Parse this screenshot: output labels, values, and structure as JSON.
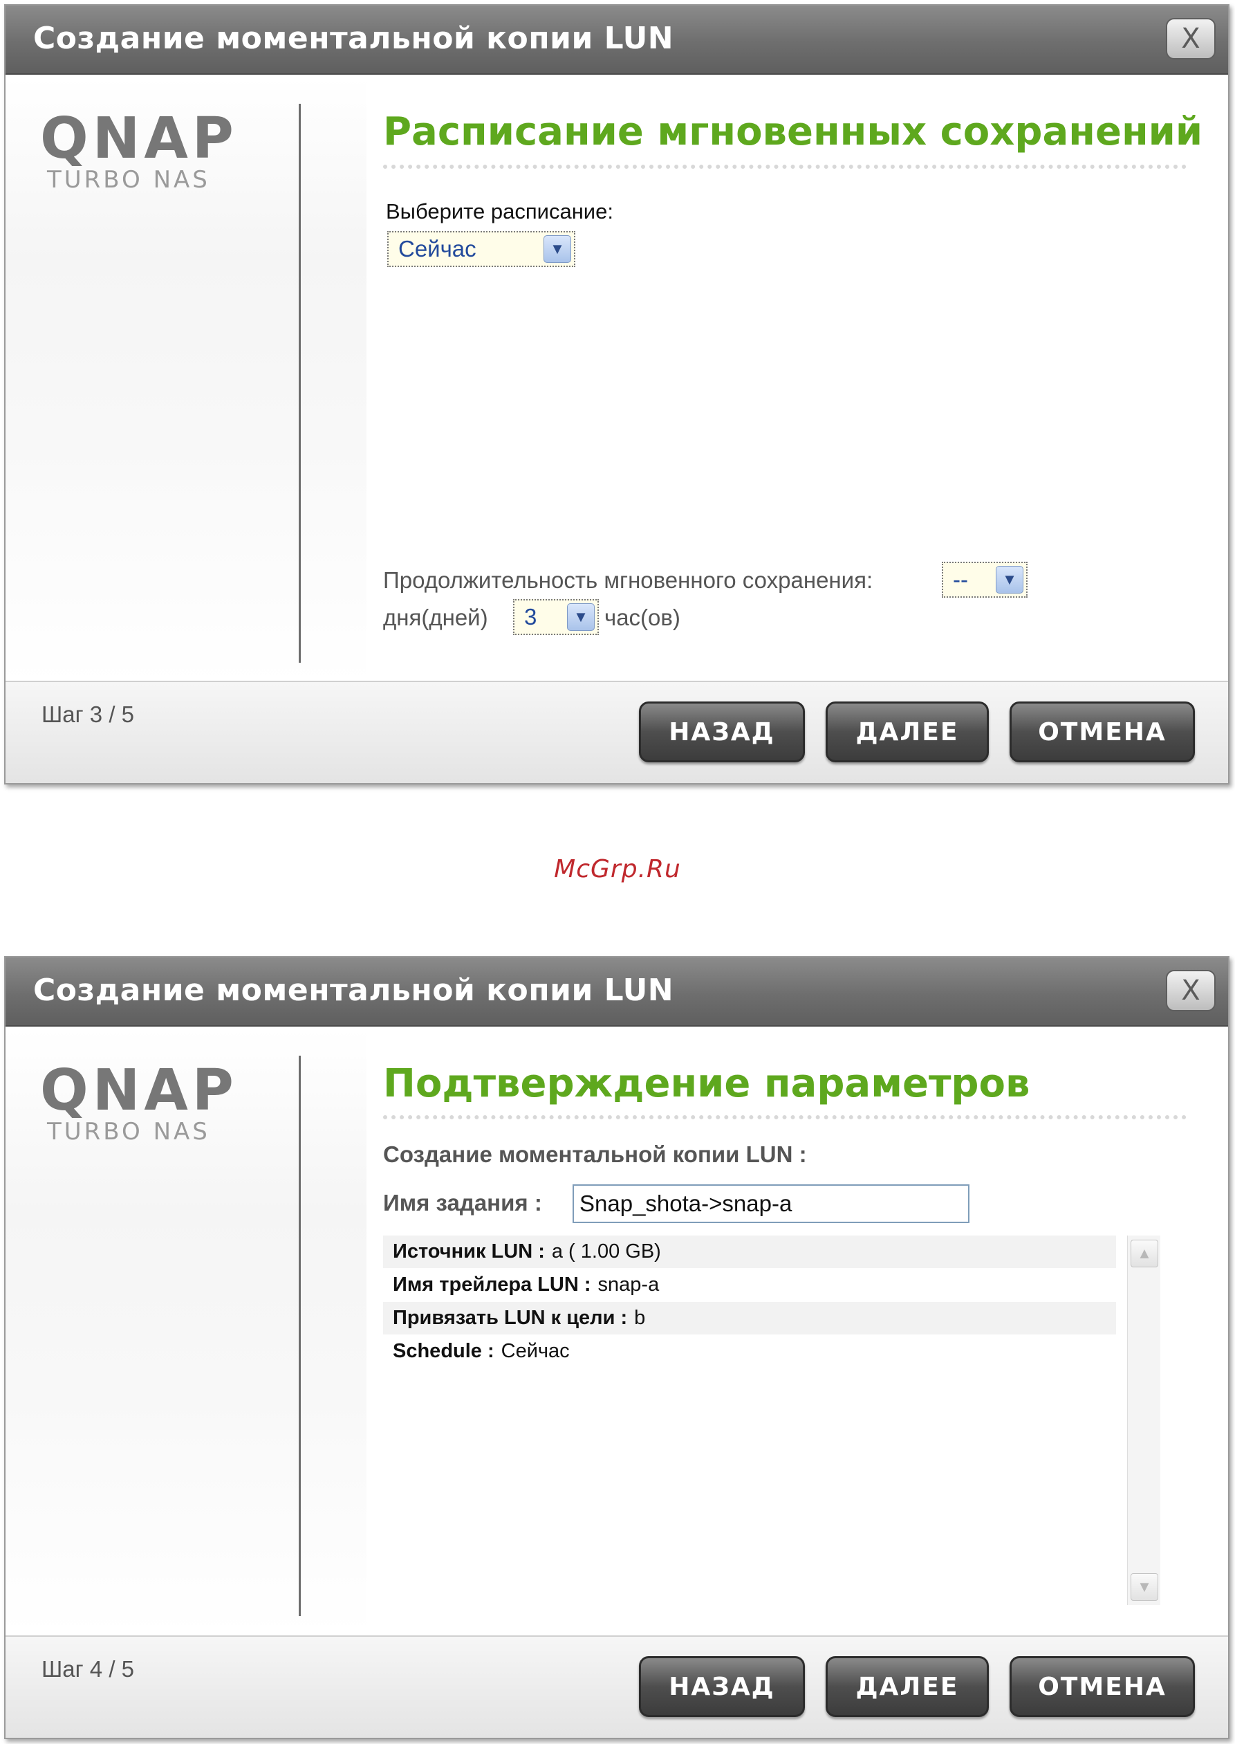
{
  "dialog1": {
    "title": "Создание моментальной копии LUN",
    "close_label": "X",
    "logo": "QNAP",
    "logo_sub": "TURBO NAS",
    "heading": "Расписание мгновенных сохранений",
    "schedule_label": "Выберите расписание:",
    "schedule_value": "Сейчас",
    "duration_label": "Продолжительность мгновенного сохранения:",
    "duration_days_value": "--",
    "days_label": "дня(дней)",
    "hours_value": "3",
    "hours_label": "час(ов)",
    "step": "Шаг 3 / 5",
    "back_label": "НАЗАД",
    "next_label": "ДАЛЕЕ",
    "cancel_label": "ОТМЕНА"
  },
  "watermark": "McGrp.Ru",
  "dialog2": {
    "title": "Создание моментальной копии LUN",
    "close_label": "X",
    "logo": "QNAP",
    "logo_sub": "TURBO NAS",
    "heading": "Подтверждение параметров",
    "section_label": "Создание моментальной копии LUN :",
    "job_name_label": "Имя задания :",
    "job_name_value": "Snap_shota->snap-a",
    "summary_rows": [
      {
        "key": "Источник LUN :",
        "value": "a  ( 1.00 GB)"
      },
      {
        "key": "Имя трейлера LUN :",
        "value": "snap-a"
      },
      {
        "key": "Привязать LUN к цели :",
        "value": "b"
      },
      {
        "key": "Schedule :",
        "value": "Сейчас"
      }
    ],
    "step": "Шаг 4 / 5",
    "back_label": "НАЗАД",
    "next_label": "ДАЛЕЕ",
    "cancel_label": "ОТМЕНА"
  }
}
